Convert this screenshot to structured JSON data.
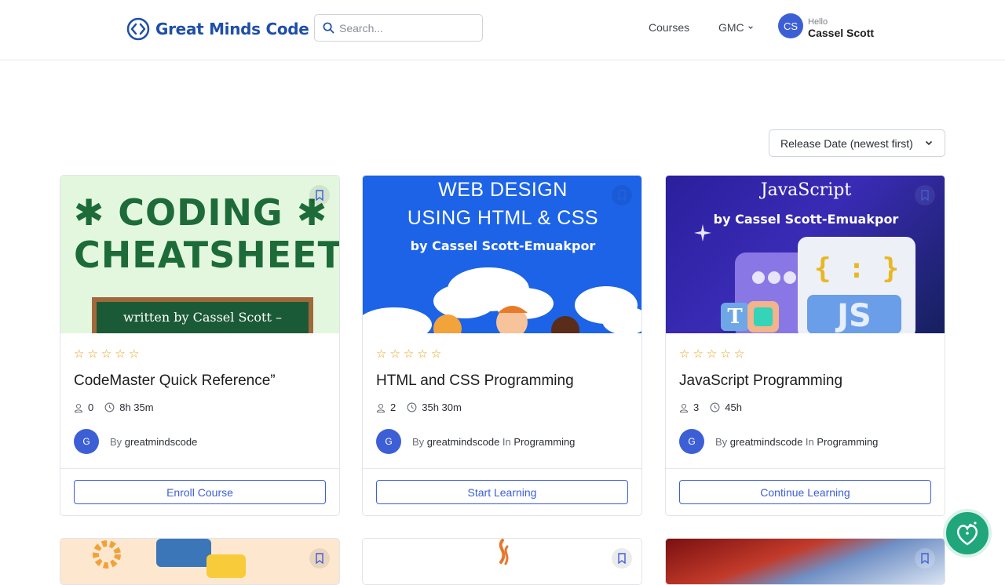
{
  "brand": {
    "name": "Great Minds Code"
  },
  "search": {
    "placeholder": "Search..."
  },
  "nav": {
    "courses": "Courses",
    "gmc": "GMC"
  },
  "user": {
    "initials": "CS",
    "greeting": "Hello",
    "name": "Cassel Scott"
  },
  "sort": {
    "selected": "Release Date (newest first)"
  },
  "courses": [
    {
      "thumb_title_1": "✱ CODING ✱",
      "thumb_title_2": "CHEATSHEET",
      "thumb_sub": "written by Cassel Scott –",
      "rating": 0,
      "title": "CodeMaster Quick Reference”",
      "students": "0",
      "duration": "8h 35m",
      "author_initial": "G",
      "by": "By",
      "author": "greatmindscode",
      "in": "",
      "category": "",
      "cta": "Enroll Course"
    },
    {
      "thumb_title_1": "WEB DESIGN",
      "thumb_title_2": "USING HTML & CSS",
      "thumb_sub": "by Cassel Scott-Emuakpor",
      "rating": 0,
      "title": "HTML and CSS Programming",
      "students": "2",
      "duration": "35h 30m",
      "author_initial": "G",
      "by": "By",
      "author": "greatmindscode",
      "in": "In",
      "category": "Programming",
      "cta": "Start Learning"
    },
    {
      "thumb_title_1": "JavaScript",
      "thumb_sub": "by Cassel Scott-Emuakpor",
      "thumb_code": "{ : }",
      "thumb_badge": "JS",
      "thumb_t": "T",
      "rating": 0,
      "title": "JavaScript Programming",
      "students": "3",
      "duration": "45h",
      "author_initial": "G",
      "by": "By",
      "author": "greatmindscode",
      "in": "In",
      "category": "Programming",
      "cta": "Continue Learning"
    }
  ],
  "colors": {
    "accent": "#3d5fd6",
    "star": "#e9a21b",
    "brand": "#1f4fa8"
  }
}
